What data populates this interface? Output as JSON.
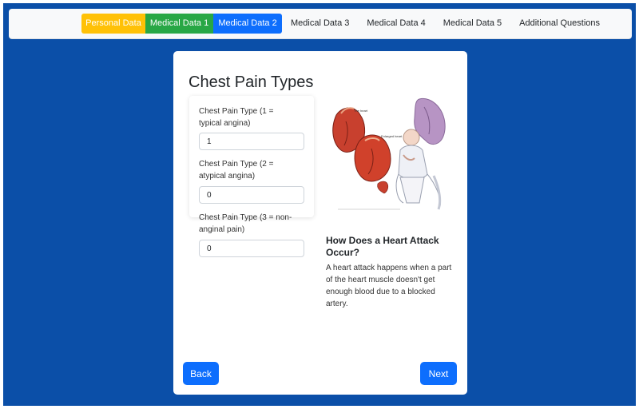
{
  "nav": {
    "tabs": [
      {
        "label": "Personal Data"
      },
      {
        "label": "Medical Data 1"
      },
      {
        "label": "Medical Data 2"
      },
      {
        "label": "Medical Data 3"
      },
      {
        "label": "Medical Data 4"
      },
      {
        "label": "Medical Data 5"
      },
      {
        "label": "Additional Questions"
      }
    ],
    "active_tab": "Medical Data 2"
  },
  "form": {
    "title": "Chest Pain Types",
    "fields": [
      {
        "label": "Chest Pain Type (1 = typical angina)",
        "value": "1"
      },
      {
        "label": "Chest Pain Type (2 = atypical angina)",
        "value": "0"
      },
      {
        "label": "Chest Pain Type (3 = non-anginal pain)",
        "value": "0"
      }
    ]
  },
  "info": {
    "image_labels": {
      "heart": "The heart",
      "enlarged": "Enlarged heart"
    },
    "title": "How Does a Heart Attack Occur?",
    "text": "A heart attack happens when a part of the heart muscle doesn't get enough blood due to a blocked artery."
  },
  "buttons": {
    "back": "Back",
    "next": "Next"
  },
  "colors": {
    "page_bg": "#0b4fa8",
    "personal_tab": "#ffc107",
    "medical1_tab": "#28a745",
    "active_tab": "#0d6efd",
    "button": "#0d6efd"
  }
}
